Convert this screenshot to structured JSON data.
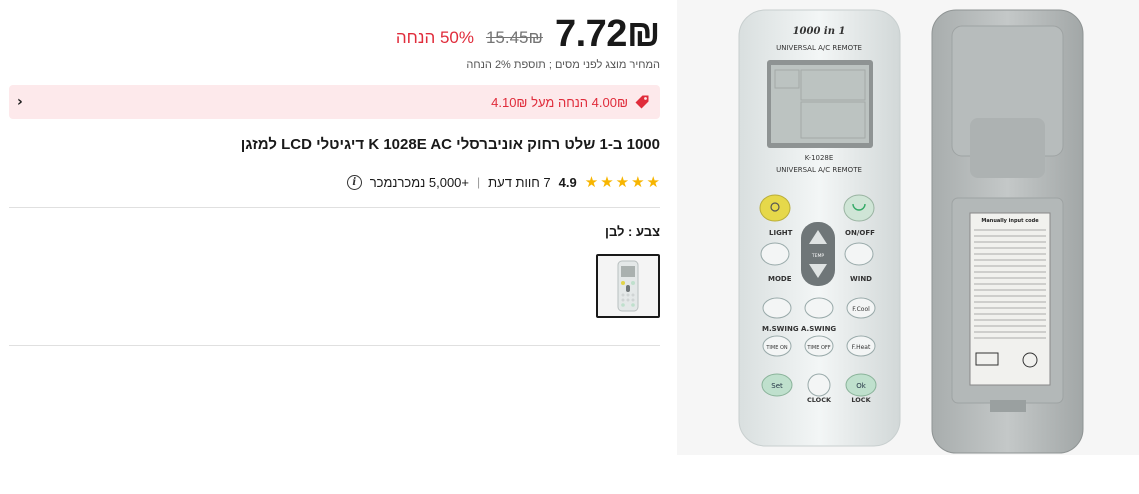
{
  "price": {
    "current": "7.72₪",
    "original": "15.45₪",
    "discount": "50% הנחה",
    "tax_note": "המחיר מוצג לפני מסים ; תוספת 2% הנחה"
  },
  "coupon": {
    "text": "4.00₪ הנחה מעל 4.10₪",
    "icon": "tag-icon"
  },
  "product": {
    "title": "1000 ב-1 שלט רחוק אוניברסלי K 1028E AC דיגיטלי LCD למזגן"
  },
  "rating": {
    "score": "4.9",
    "stars": 5,
    "reviews": "7 חוות דעת",
    "sold": "+5,000 נמכרנמכר"
  },
  "color": {
    "label": "צבע : לבן"
  },
  "image_text": {
    "brand_top": "1000 in 1",
    "brand_line": "UNIVERSAL A/C REMOTE",
    "model": "K-1028E",
    "light": "LIGHT",
    "onoff": "ON/OFF",
    "mode": "MODE",
    "wind": "WIND",
    "temp": "TEMP",
    "mswing": "M.SWING",
    "aswing": "A.SWING",
    "fcool": "F.Cool",
    "fheat": "F.Heat",
    "timeon": "TIME ON",
    "timeoff": "TIME OFF",
    "set": "Set",
    "ok": "Ok",
    "clock": "CLOCK",
    "lock": "LOCK",
    "manual": "Manually input code"
  },
  "colors": {
    "accent_red": "#e02c3b",
    "coupon_bg": "#fde9eb",
    "star": "#f7b500"
  }
}
